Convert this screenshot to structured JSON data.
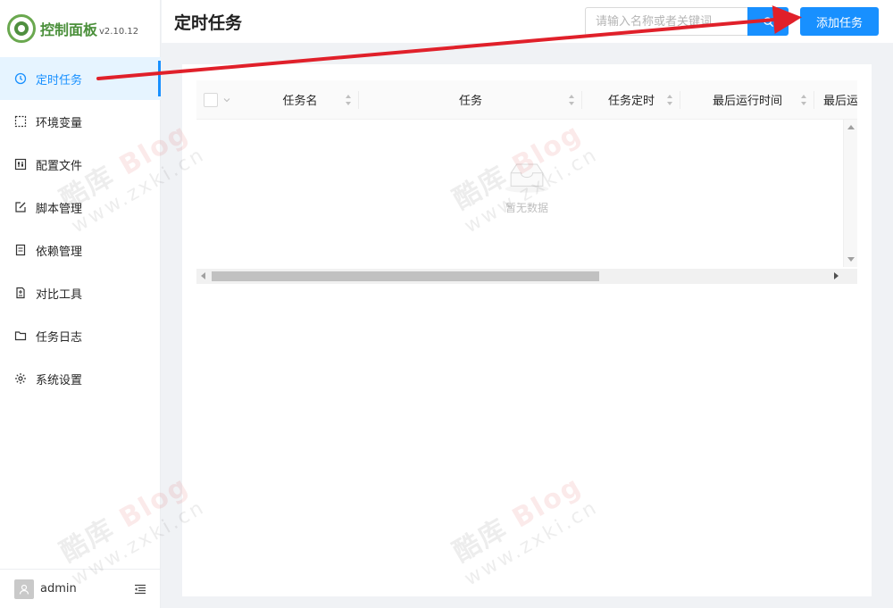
{
  "app": {
    "title": "控制面板",
    "version": "v2.10.12"
  },
  "sidebar": {
    "items": [
      {
        "label": "定时任务",
        "icon": "clock-icon",
        "active": true
      },
      {
        "label": "环境变量",
        "icon": "dashed-square-icon",
        "active": false
      },
      {
        "label": "配置文件",
        "icon": "sliders-icon",
        "active": false
      },
      {
        "label": "脚本管理",
        "icon": "edit-icon",
        "active": false
      },
      {
        "label": "依赖管理",
        "icon": "package-icon",
        "active": false
      },
      {
        "label": "对比工具",
        "icon": "file-diff-icon",
        "active": false
      },
      {
        "label": "任务日志",
        "icon": "folder-icon",
        "active": false
      },
      {
        "label": "系统设置",
        "icon": "gear-icon",
        "active": false
      }
    ],
    "user": {
      "name": "admin"
    }
  },
  "header": {
    "title": "定时任务",
    "search_placeholder": "请输入名称或者关键词",
    "add_button": "添加任务"
  },
  "table": {
    "columns": [
      "任务名",
      "任务",
      "任务定时",
      "最后运行时间",
      "最后运"
    ],
    "rows": [],
    "empty_text": "暂无数据"
  },
  "watermark": {
    "brand": "酷库",
    "blog": "Blog",
    "domain": "www.zxki.cn"
  },
  "colors": {
    "accent": "#1890ff",
    "active_bg": "#e6f4ff",
    "annotation_arrow": "#e0202a",
    "logo_green": "#4a8f3a"
  }
}
